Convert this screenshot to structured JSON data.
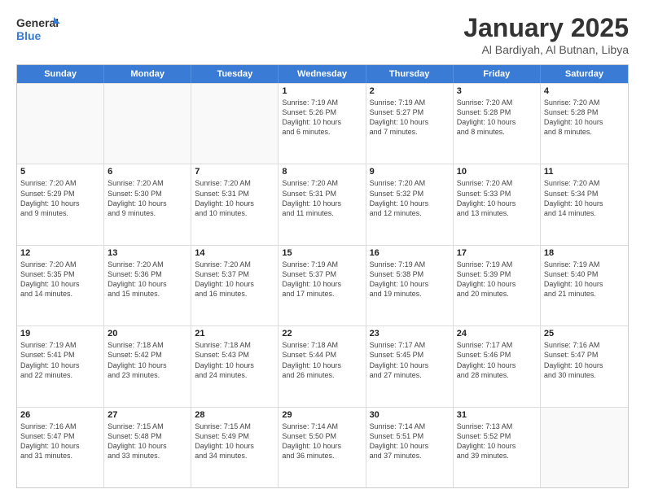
{
  "header": {
    "logo_line1": "General",
    "logo_line2": "Blue",
    "month": "January 2025",
    "location": "Al Bardiyah, Al Butnan, Libya"
  },
  "weekdays": [
    "Sunday",
    "Monday",
    "Tuesday",
    "Wednesday",
    "Thursday",
    "Friday",
    "Saturday"
  ],
  "rows": [
    [
      {
        "num": "",
        "info": ""
      },
      {
        "num": "",
        "info": ""
      },
      {
        "num": "",
        "info": ""
      },
      {
        "num": "1",
        "info": "Sunrise: 7:19 AM\nSunset: 5:26 PM\nDaylight: 10 hours\nand 6 minutes."
      },
      {
        "num": "2",
        "info": "Sunrise: 7:19 AM\nSunset: 5:27 PM\nDaylight: 10 hours\nand 7 minutes."
      },
      {
        "num": "3",
        "info": "Sunrise: 7:20 AM\nSunset: 5:28 PM\nDaylight: 10 hours\nand 8 minutes."
      },
      {
        "num": "4",
        "info": "Sunrise: 7:20 AM\nSunset: 5:28 PM\nDaylight: 10 hours\nand 8 minutes."
      }
    ],
    [
      {
        "num": "5",
        "info": "Sunrise: 7:20 AM\nSunset: 5:29 PM\nDaylight: 10 hours\nand 9 minutes."
      },
      {
        "num": "6",
        "info": "Sunrise: 7:20 AM\nSunset: 5:30 PM\nDaylight: 10 hours\nand 9 minutes."
      },
      {
        "num": "7",
        "info": "Sunrise: 7:20 AM\nSunset: 5:31 PM\nDaylight: 10 hours\nand 10 minutes."
      },
      {
        "num": "8",
        "info": "Sunrise: 7:20 AM\nSunset: 5:31 PM\nDaylight: 10 hours\nand 11 minutes."
      },
      {
        "num": "9",
        "info": "Sunrise: 7:20 AM\nSunset: 5:32 PM\nDaylight: 10 hours\nand 12 minutes."
      },
      {
        "num": "10",
        "info": "Sunrise: 7:20 AM\nSunset: 5:33 PM\nDaylight: 10 hours\nand 13 minutes."
      },
      {
        "num": "11",
        "info": "Sunrise: 7:20 AM\nSunset: 5:34 PM\nDaylight: 10 hours\nand 14 minutes."
      }
    ],
    [
      {
        "num": "12",
        "info": "Sunrise: 7:20 AM\nSunset: 5:35 PM\nDaylight: 10 hours\nand 14 minutes."
      },
      {
        "num": "13",
        "info": "Sunrise: 7:20 AM\nSunset: 5:36 PM\nDaylight: 10 hours\nand 15 minutes."
      },
      {
        "num": "14",
        "info": "Sunrise: 7:20 AM\nSunset: 5:37 PM\nDaylight: 10 hours\nand 16 minutes."
      },
      {
        "num": "15",
        "info": "Sunrise: 7:19 AM\nSunset: 5:37 PM\nDaylight: 10 hours\nand 17 minutes."
      },
      {
        "num": "16",
        "info": "Sunrise: 7:19 AM\nSunset: 5:38 PM\nDaylight: 10 hours\nand 19 minutes."
      },
      {
        "num": "17",
        "info": "Sunrise: 7:19 AM\nSunset: 5:39 PM\nDaylight: 10 hours\nand 20 minutes."
      },
      {
        "num": "18",
        "info": "Sunrise: 7:19 AM\nSunset: 5:40 PM\nDaylight: 10 hours\nand 21 minutes."
      }
    ],
    [
      {
        "num": "19",
        "info": "Sunrise: 7:19 AM\nSunset: 5:41 PM\nDaylight: 10 hours\nand 22 minutes."
      },
      {
        "num": "20",
        "info": "Sunrise: 7:18 AM\nSunset: 5:42 PM\nDaylight: 10 hours\nand 23 minutes."
      },
      {
        "num": "21",
        "info": "Sunrise: 7:18 AM\nSunset: 5:43 PM\nDaylight: 10 hours\nand 24 minutes."
      },
      {
        "num": "22",
        "info": "Sunrise: 7:18 AM\nSunset: 5:44 PM\nDaylight: 10 hours\nand 26 minutes."
      },
      {
        "num": "23",
        "info": "Sunrise: 7:17 AM\nSunset: 5:45 PM\nDaylight: 10 hours\nand 27 minutes."
      },
      {
        "num": "24",
        "info": "Sunrise: 7:17 AM\nSunset: 5:46 PM\nDaylight: 10 hours\nand 28 minutes."
      },
      {
        "num": "25",
        "info": "Sunrise: 7:16 AM\nSunset: 5:47 PM\nDaylight: 10 hours\nand 30 minutes."
      }
    ],
    [
      {
        "num": "26",
        "info": "Sunrise: 7:16 AM\nSunset: 5:47 PM\nDaylight: 10 hours\nand 31 minutes."
      },
      {
        "num": "27",
        "info": "Sunrise: 7:15 AM\nSunset: 5:48 PM\nDaylight: 10 hours\nand 33 minutes."
      },
      {
        "num": "28",
        "info": "Sunrise: 7:15 AM\nSunset: 5:49 PM\nDaylight: 10 hours\nand 34 minutes."
      },
      {
        "num": "29",
        "info": "Sunrise: 7:14 AM\nSunset: 5:50 PM\nDaylight: 10 hours\nand 36 minutes."
      },
      {
        "num": "30",
        "info": "Sunrise: 7:14 AM\nSunset: 5:51 PM\nDaylight: 10 hours\nand 37 minutes."
      },
      {
        "num": "31",
        "info": "Sunrise: 7:13 AM\nSunset: 5:52 PM\nDaylight: 10 hours\nand 39 minutes."
      },
      {
        "num": "",
        "info": ""
      }
    ]
  ]
}
